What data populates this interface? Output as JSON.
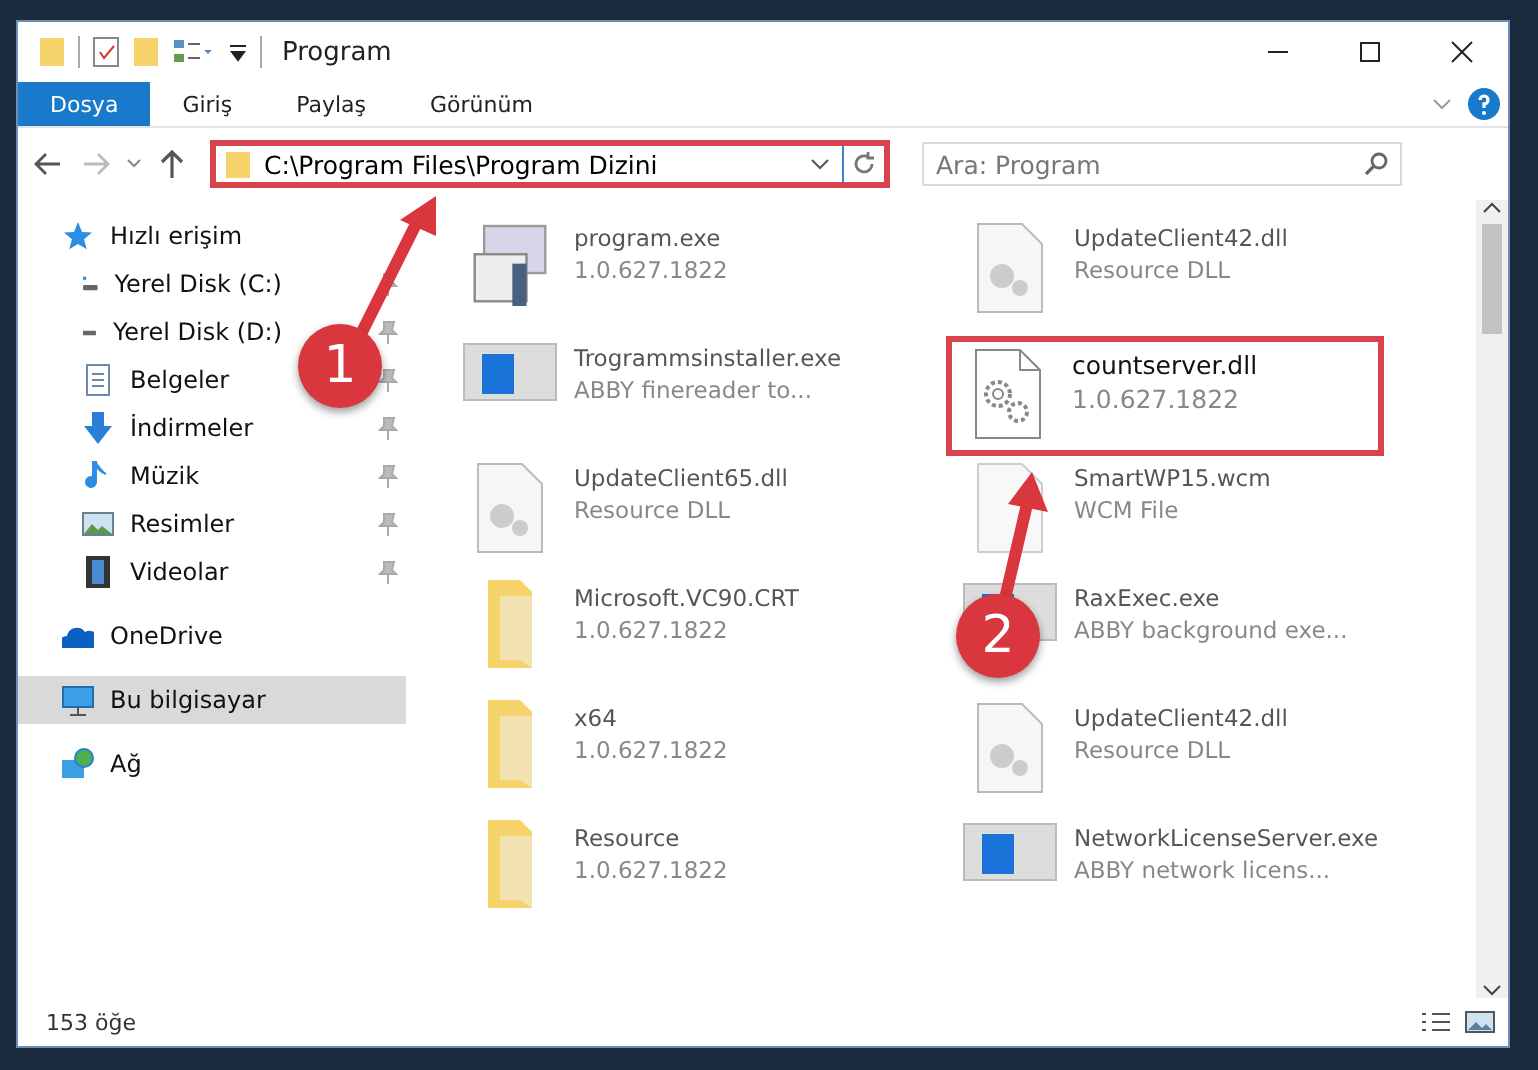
{
  "window": {
    "title": "Program"
  },
  "ribbon_tabs": [
    {
      "label": "Dosya",
      "selected": true
    },
    {
      "label": "Giriş",
      "selected": false
    },
    {
      "label": "Paylaş",
      "selected": false
    },
    {
      "label": "Görünüm",
      "selected": false
    }
  ],
  "address": {
    "value": "C:\\Program Files\\Program Dizini",
    "highlighted": true
  },
  "search": {
    "placeholder": "Ara: Program"
  },
  "sidebar": {
    "items": [
      {
        "kind": "star",
        "label": "Hızlı erişim",
        "pinned": false,
        "selected": false,
        "indent": false
      },
      {
        "kind": "disk-c",
        "label": "Yerel Disk (C:)",
        "pinned": true,
        "selected": false,
        "indent": true
      },
      {
        "kind": "disk",
        "label": "Yerel Disk (D:)",
        "pinned": true,
        "selected": false,
        "indent": true
      },
      {
        "kind": "docs",
        "label": "Belgeler",
        "pinned": true,
        "selected": false,
        "indent": true
      },
      {
        "kind": "download",
        "label": "İndirmeler",
        "pinned": true,
        "selected": false,
        "indent": true
      },
      {
        "kind": "music",
        "label": "Müzik",
        "pinned": true,
        "selected": false,
        "indent": true
      },
      {
        "kind": "pictures",
        "label": "Resimler",
        "pinned": true,
        "selected": false,
        "indent": true
      },
      {
        "kind": "video",
        "label": "Videolar",
        "pinned": true,
        "selected": false,
        "indent": true
      },
      {
        "kind": "cloud",
        "label": "OneDrive",
        "pinned": false,
        "selected": false,
        "indent": false
      },
      {
        "kind": "pc",
        "label": "Bu bilgisayar",
        "pinned": false,
        "selected": true,
        "indent": false
      },
      {
        "kind": "network",
        "label": "Ağ",
        "pinned": false,
        "selected": false,
        "indent": false
      }
    ]
  },
  "files": [
    {
      "kind": "exe",
      "name": "program.exe",
      "detail": "1.0.627.1822",
      "highlighted": false
    },
    {
      "kind": "dll",
      "name": "UpdateClient42.dll",
      "detail": "Resource DLL",
      "highlighted": false
    },
    {
      "kind": "app",
      "name": "Trogrammsinstaller.exe",
      "detail": "ABBY finereader to...",
      "highlighted": false
    },
    {
      "kind": "gear",
      "name": "countserver.dll",
      "detail": "1.0.627.1822",
      "highlighted": true
    },
    {
      "kind": "dll",
      "name": "UpdateClient65.dll",
      "detail": "Resource DLL",
      "highlighted": false
    },
    {
      "kind": "file",
      "name": "SmartWP15.wcm",
      "detail": "WCM File",
      "highlighted": false
    },
    {
      "kind": "folder",
      "name": "Microsoft.VC90.CRT",
      "detail": "1.0.627.1822",
      "highlighted": false
    },
    {
      "kind": "app",
      "name": "RaxExec.exe",
      "detail": "ABBY background exe...",
      "highlighted": false
    },
    {
      "kind": "folder",
      "name": "x64",
      "detail": "1.0.627.1822",
      "highlighted": false
    },
    {
      "kind": "dll",
      "name": "UpdateClient42.dll",
      "detail": "Resource DLL",
      "highlighted": false
    },
    {
      "kind": "folder",
      "name": "Resource",
      "detail": "1.0.627.1822",
      "highlighted": false
    },
    {
      "kind": "app",
      "name": "NetworkLicenseServer.exe",
      "detail": "ABBY network licens...",
      "highlighted": false
    }
  ],
  "callouts": [
    {
      "number": "1"
    },
    {
      "number": "2"
    }
  ],
  "status_bar": {
    "count": "153 öğe"
  }
}
